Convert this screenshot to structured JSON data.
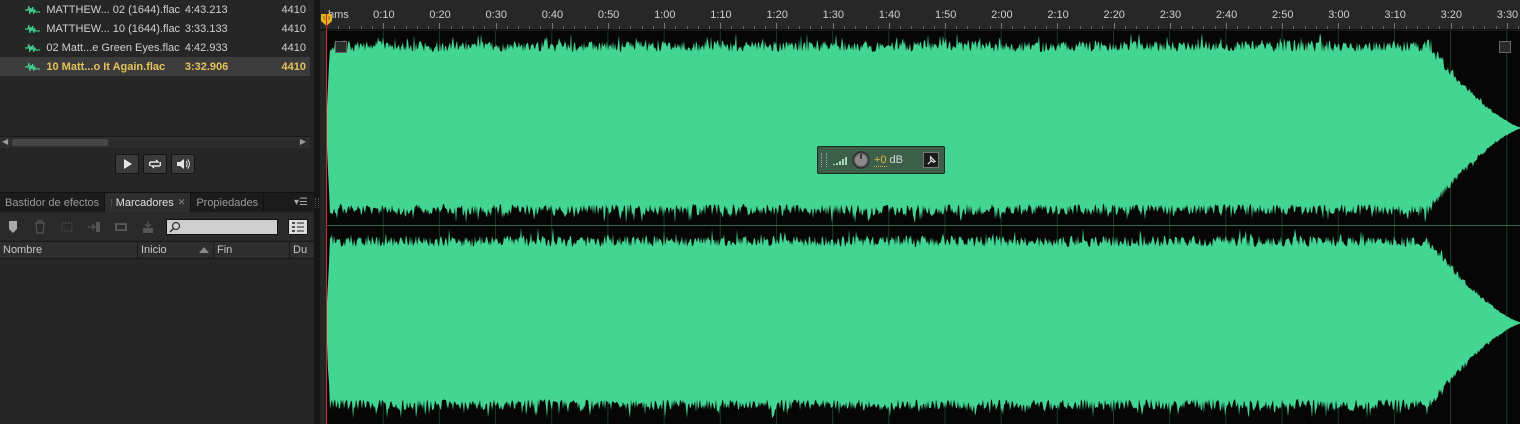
{
  "files": [
    {
      "name": "MATTHEW... 02 (1644).flac",
      "duration": "4:43.213",
      "rate": "4410",
      "selected": false
    },
    {
      "name": "MATTHEW... 10 (1644).flac",
      "duration": "3:33.133",
      "rate": "4410",
      "selected": false
    },
    {
      "name": "02 Matt...e Green Eyes.flac",
      "duration": "4:42.933",
      "rate": "4410",
      "selected": false
    },
    {
      "name": "10 Matt...o It Again.flac",
      "duration": "3:32.906",
      "rate": "4410",
      "selected": true
    }
  ],
  "transport": {
    "play_icon": "play-icon",
    "loop_icon": "loop-icon",
    "autoplay_icon": "speaker-icon"
  },
  "tabs": [
    {
      "label": "Bastidor de efectos",
      "active": false,
      "closable": false
    },
    {
      "label": "Marcadores",
      "active": true,
      "closable": true
    },
    {
      "label": "Propiedades",
      "active": false,
      "closable": false
    }
  ],
  "markers": {
    "search_value": "",
    "columns": {
      "name": "Nombre",
      "start": "Inicio",
      "end": "Fin",
      "duration": "Du"
    },
    "rows": []
  },
  "ruler": {
    "unit_label": "hms",
    "ticks": [
      "0:10",
      "0:20",
      "0:30",
      "0:40",
      "0:50",
      "1:00",
      "1:10",
      "1:20",
      "1:30",
      "1:40",
      "1:50",
      "2:00",
      "2:10",
      "2:20",
      "2:30",
      "2:40",
      "2:50",
      "3:00",
      "3:10",
      "3:20",
      "3:30"
    ]
  },
  "hud": {
    "value": "+0",
    "unit": "dB"
  },
  "waveform": {
    "duration_s": 212.906,
    "view_end_s": 213.5,
    "fade_start_s": 196,
    "channels": 2
  },
  "colors": {
    "waveform": "#43d693",
    "playhead": "#cc2222",
    "selected_file": "#e6c25a",
    "hud_bg": "#3c5f4a",
    "hud_value": "#e2b83a"
  }
}
